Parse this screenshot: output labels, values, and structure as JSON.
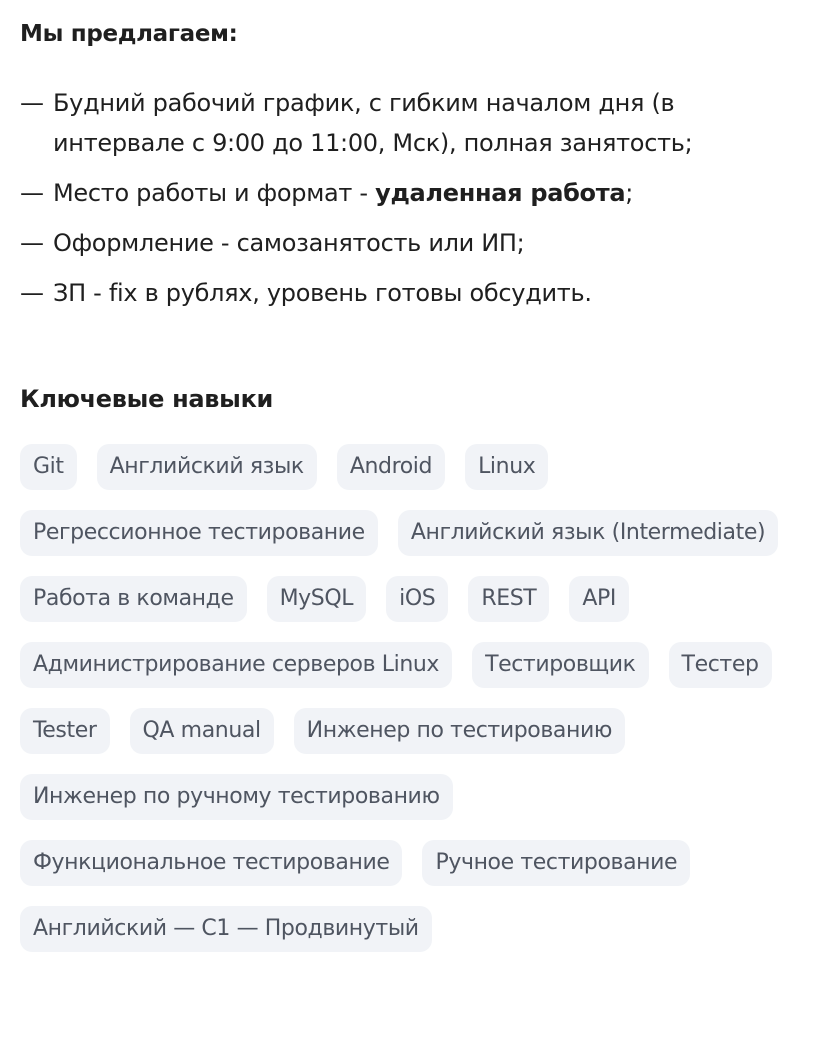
{
  "offer": {
    "title": "Мы предлагаем:",
    "items": [
      {
        "text": "Будний рабочий график, с гибким началом дня (в интервале с 9:00 до 11:00, Мск), полная занятость;"
      },
      {
        "before": "Место работы и формат - ",
        "bold": "удаленная работа",
        "after": ";"
      },
      {
        "text": "Оформление - самозанятость или ИП;"
      },
      {
        "text": "ЗП - fix в рублях, уровень готовы обсудить."
      }
    ]
  },
  "skills": {
    "title": "Ключевые навыки",
    "tags": [
      "Git",
      "Английский язык",
      "Android",
      "Linux",
      "Регрессионное тестирование",
      "Английский язык (Intermediate)",
      "Работа в команде",
      "MySQL",
      "iOS",
      "REST",
      "API",
      "Администрирование серверов Linux",
      "Тестировщик",
      "Тестер",
      "Tester",
      "QA manual",
      "Инженер по тестированию",
      "Инженер по ручному тестированию",
      "Функциональное тестирование",
      "Ручное тестирование",
      "Английский — C1 — Продвинутый"
    ]
  }
}
